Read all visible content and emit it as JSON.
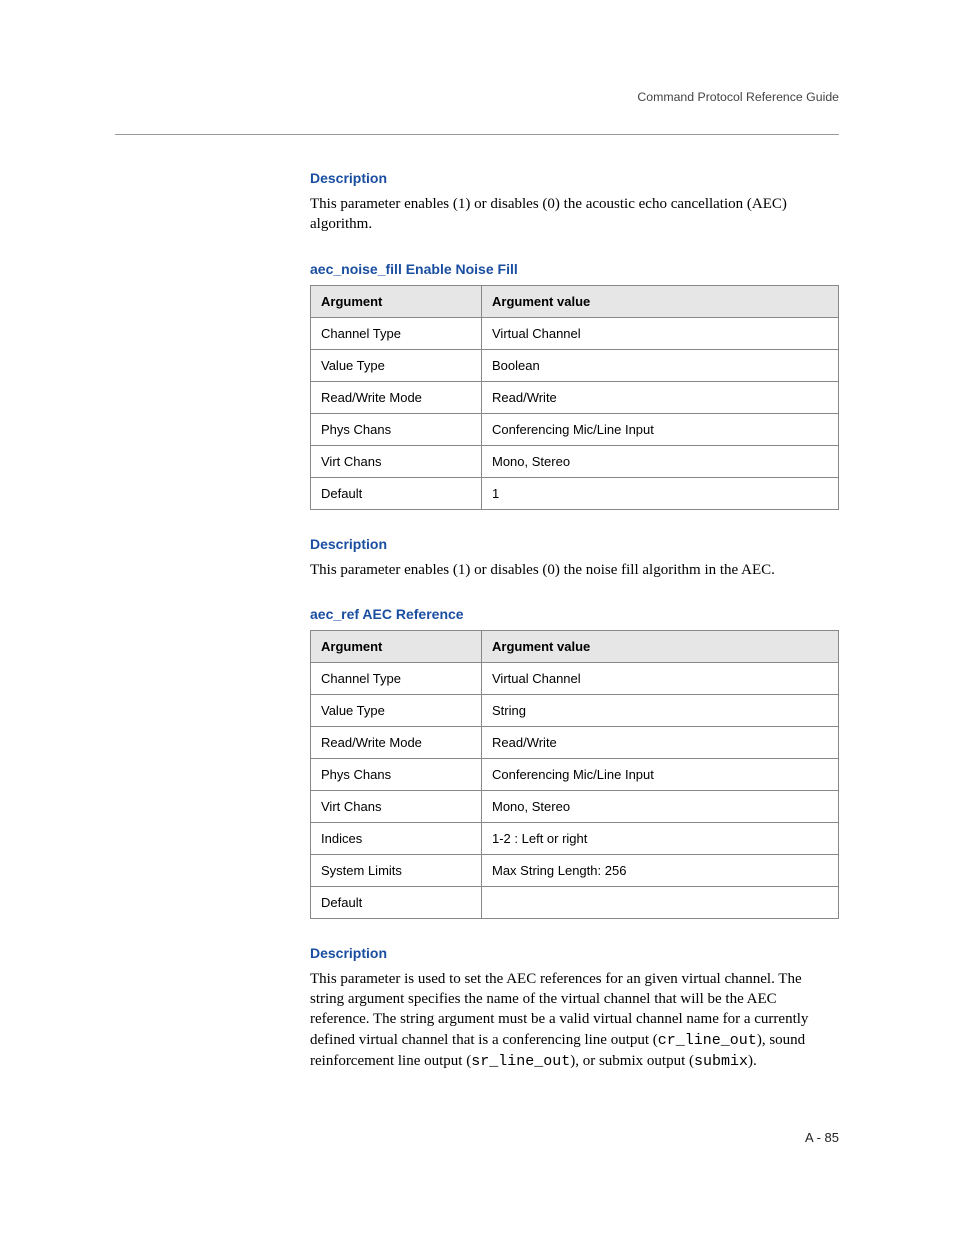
{
  "header": {
    "title": "Command Protocol Reference Guide"
  },
  "section1": {
    "heading": "Description",
    "body": "This parameter enables (1) or disables (0) the acoustic echo cancellation (AEC) algorithm."
  },
  "section2": {
    "heading": "aec_noise_fill Enable Noise Fill",
    "table": {
      "head_arg": "Argument",
      "head_val": "Argument value",
      "rows": [
        {
          "arg": "Channel Type",
          "val": "Virtual Channel"
        },
        {
          "arg": "Value Type",
          "val": "Boolean"
        },
        {
          "arg": "Read/Write Mode",
          "val": "Read/Write"
        },
        {
          "arg": "Phys Chans",
          "val": "Conferencing Mic/Line Input"
        },
        {
          "arg": "Virt Chans",
          "val": "Mono, Stereo"
        },
        {
          "arg": "Default",
          "val": "1"
        }
      ]
    }
  },
  "section3": {
    "heading": "Description",
    "body": "This parameter enables (1) or disables (0) the noise fill algorithm in the AEC."
  },
  "section4": {
    "heading": "aec_ref AEC Reference",
    "table": {
      "head_arg": "Argument",
      "head_val": "Argument value",
      "rows": [
        {
          "arg": "Channel Type",
          "val": "Virtual Channel"
        },
        {
          "arg": "Value Type",
          "val": "String"
        },
        {
          "arg": "Read/Write Mode",
          "val": "Read/Write"
        },
        {
          "arg": "Phys Chans",
          "val": "Conferencing Mic/Line Input"
        },
        {
          "arg": "Virt Chans",
          "val": "Mono, Stereo"
        },
        {
          "arg": "Indices",
          "val": "1-2 : Left or right"
        },
        {
          "arg": "System Limits",
          "val": "Max String Length: 256"
        },
        {
          "arg": "Default",
          "val": ""
        }
      ]
    }
  },
  "section5": {
    "heading": "Description",
    "body_pre": "This parameter is used to set the AEC references for an given virtual channel. The string argument specifies the name of the virtual channel that will be the AEC reference. The string argument must be a valid virtual channel name for a currently defined virtual channel that is a conferencing line output (",
    "code1": "cr_line_out",
    "mid1": "), sound reinforcement line output (",
    "code2": "sr_line_out",
    "mid2": "), or submix output (",
    "code3": "submix",
    "tail": ")."
  },
  "footer": {
    "page": "A - 85"
  }
}
